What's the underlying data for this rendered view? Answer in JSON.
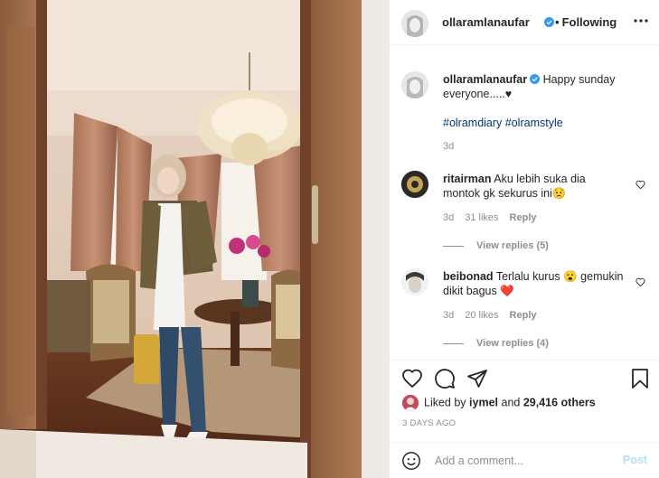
{
  "post": {
    "username": "ollaramlanaufar",
    "verified": true,
    "follow_status": "Following",
    "caption": "Happy sunday everyone.....♥",
    "hashtags": "#olramdiary #olramstyle",
    "caption_age": "3d"
  },
  "comments": [
    {
      "username": "ritairman",
      "text": "Aku lebih suka dia montok gk sekurus ini😟",
      "age": "3d",
      "likes": "31 likes",
      "reply": "Reply",
      "view_replies": "View replies (5)"
    },
    {
      "username": "beibonad",
      "text": "Terlalu kurus 😮 gemukin dikit bagus ❤️",
      "age": "3d",
      "likes": "20 likes",
      "reply": "Reply",
      "view_replies": "View replies (4)"
    }
  ],
  "likes": {
    "prefix": "Liked by",
    "user": "iymel",
    "joiner": "and",
    "others": "29,416 others"
  },
  "timestamp": "3 DAYS AGO",
  "add_comment": {
    "placeholder": "Add a comment...",
    "post_label": "Post"
  },
  "colors": {
    "link": "#00376b",
    "verified": "#3897f0",
    "post_disabled": "#b2dffc",
    "secondary_text": "#8e8e8e"
  }
}
